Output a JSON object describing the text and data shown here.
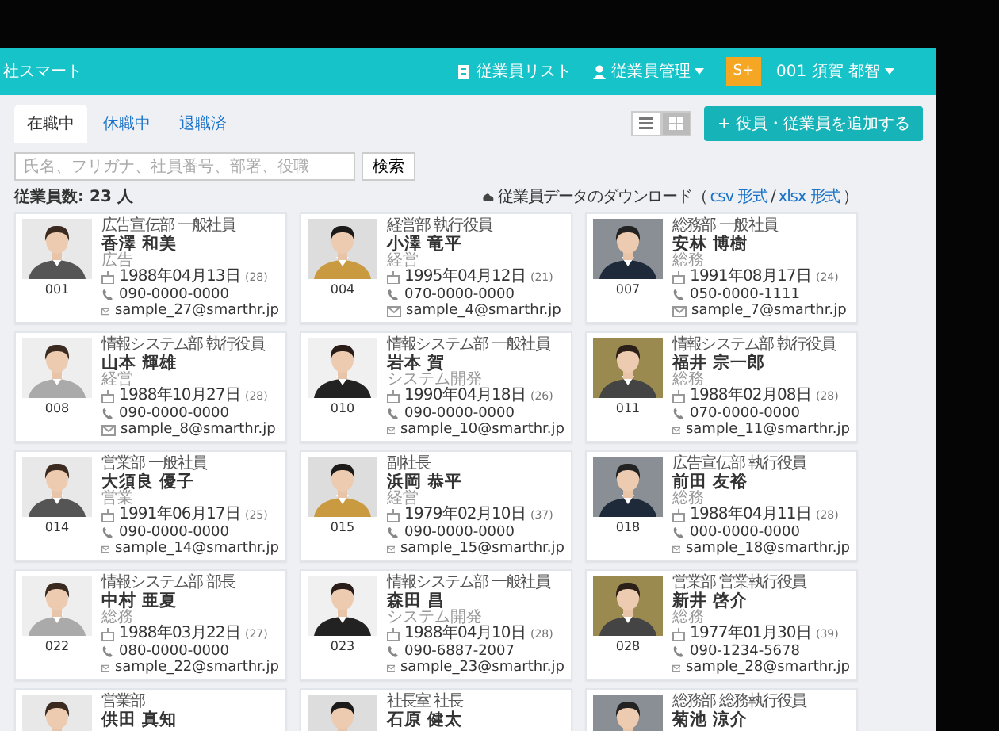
{
  "header": {
    "logo": "社スマート",
    "nav": [
      {
        "label": "従業員リスト",
        "kind": "list",
        "caret": false
      },
      {
        "label": "従業員管理",
        "kind": "person",
        "caret": true
      }
    ],
    "badge": "S+",
    "user": "001 須賀 都智"
  },
  "status_tabs": [
    {
      "label": "在職中",
      "selected": true
    },
    {
      "label": "休職中",
      "selected": false
    },
    {
      "label": "退職済",
      "selected": false
    }
  ],
  "view_toggle": [
    {
      "kind": "list",
      "selected": false
    },
    {
      "kind": "grid",
      "selected": true
    }
  ],
  "add_button": "+ 役員・従業員を追加する",
  "search": {
    "placeholder": "氏名、フリガナ、社員番号、部署、役職",
    "button": "検索"
  },
  "count": "従業員数: 23 人",
  "download": {
    "label": "従業員データのダウンロード（",
    "links": [
      "csv 形式",
      "xlsx 形式"
    ],
    "separator": "/",
    "end": "）"
  },
  "employees": [
    {
      "number": "001",
      "department": "広告宣伝部 一般社員",
      "name": "香澤 和美",
      "title": "広告",
      "birthday": "1988年04月13日",
      "age": "(28)",
      "phone": "090-0000-0000",
      "email": "sample_27@smarthr.jp"
    },
    {
      "number": "004",
      "department": "経営部 執行役員",
      "name": "小澤 竜平",
      "title": "経営",
      "birthday": "1995年04月12日",
      "age": "(21)",
      "phone": "070-0000-0000",
      "email": "sample_4@smarthr.jp"
    },
    {
      "number": "007",
      "department": "総務部 一般社員",
      "name": "安林 博樹",
      "title": "総務",
      "birthday": "1991年08月17日",
      "age": "(24)",
      "phone": "050-0000-1111",
      "email": "sample_7@smarthr.jp"
    },
    {
      "number": "008",
      "department": "情報システム部 執行役員",
      "name": "山本 輝雄",
      "title": "経営",
      "birthday": "1988年10月27日",
      "age": "(28)",
      "phone": "090-0000-0000",
      "email": "sample_8@smarthr.jp"
    },
    {
      "number": "010",
      "department": "情報システム部 一般社員",
      "name": "岩本 賀",
      "title": "システム開発",
      "birthday": "1990年04月18日",
      "age": "(26)",
      "phone": "090-0000-0000",
      "email": "sample_10@smarthr.jp"
    },
    {
      "number": "011",
      "department": "情報システム部 執行役員",
      "name": "福井 宗一郎",
      "title": "総務",
      "birthday": "1988年02月08日",
      "age": "(28)",
      "phone": "070-0000-0000",
      "email": "sample_11@smarthr.jp"
    },
    {
      "number": "014",
      "department": "営業部 一般社員",
      "name": "大須良 優子",
      "title": "営業",
      "birthday": "1991年06月17日",
      "age": "(25)",
      "phone": "090-0000-0000",
      "email": "sample_14@smarthr.jp"
    },
    {
      "number": "015",
      "department": "副社長",
      "name": "浜岡 恭平",
      "title": "経営",
      "birthday": "1979年02月10日",
      "age": "(37)",
      "phone": "090-0000-0000",
      "email": "sample_15@smarthr.jp"
    },
    {
      "number": "018",
      "department": "広告宣伝部 執行役員",
      "name": "前田 友裕",
      "title": "総務",
      "birthday": "1988年04月11日",
      "age": "(28)",
      "phone": "000-0000-0000",
      "email": "sample_18@smarthr.jp"
    },
    {
      "number": "022",
      "department": "情報システム部 部長",
      "name": "中村 亜夏",
      "title": "総務",
      "birthday": "1988年03月22日",
      "age": "(27)",
      "phone": "080-0000-0000",
      "email": "sample_22@smarthr.jp"
    },
    {
      "number": "023",
      "department": "情報システム部 一般社員",
      "name": "森田 昌",
      "title": "システム開発",
      "birthday": "1988年04月10日",
      "age": "(28)",
      "phone": "090-6887-2007",
      "email": "sample_23@smarthr.jp"
    },
    {
      "number": "028",
      "department": "営業部 営業執行役員",
      "name": "新井 啓介",
      "title": "総務",
      "birthday": "1977年01月30日",
      "age": "(39)",
      "phone": "090-1234-5678",
      "email": "sample_28@smarthr.jp"
    },
    {
      "department": "営業部",
      "name": "供田 真知"
    },
    {
      "department": "社長室 社長",
      "name": "石原 健太"
    },
    {
      "department": "総務部 総務執行役員",
      "name": "菊池 涼介"
    }
  ]
}
